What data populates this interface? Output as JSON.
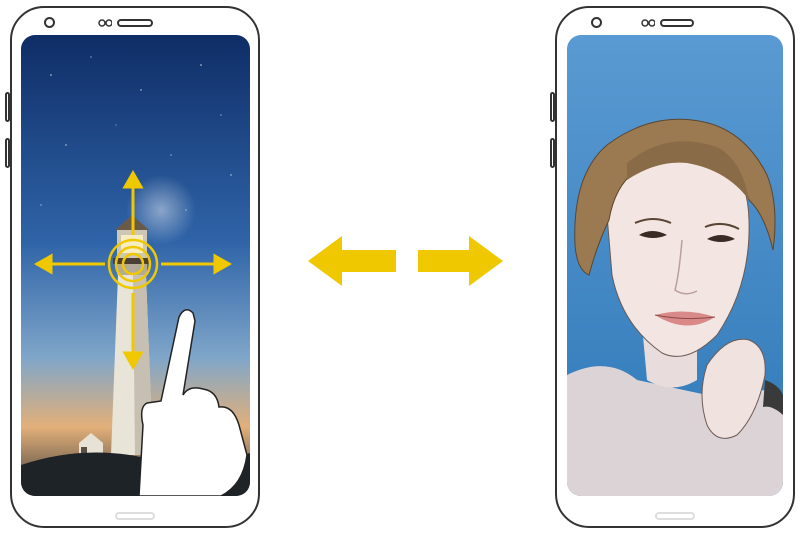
{
  "illustration": {
    "left_phone": {
      "screen": "lighthouse-wallpaper",
      "gesture": "touch-and-drag-arrows",
      "colors": {
        "sky_top": "#173a78",
        "sky_mid": "#3b6fb0",
        "horizon": "#e8a560",
        "arrow": "#f0c800"
      }
    },
    "switch_arrows": {
      "color": "#f0c800",
      "directions": [
        "left",
        "right"
      ]
    },
    "right_phone": {
      "screen": "selfie-portrait",
      "colors": {
        "background": "#3c86c4",
        "hair": "#9b7a52",
        "skin": "#f3e6e2"
      }
    }
  }
}
